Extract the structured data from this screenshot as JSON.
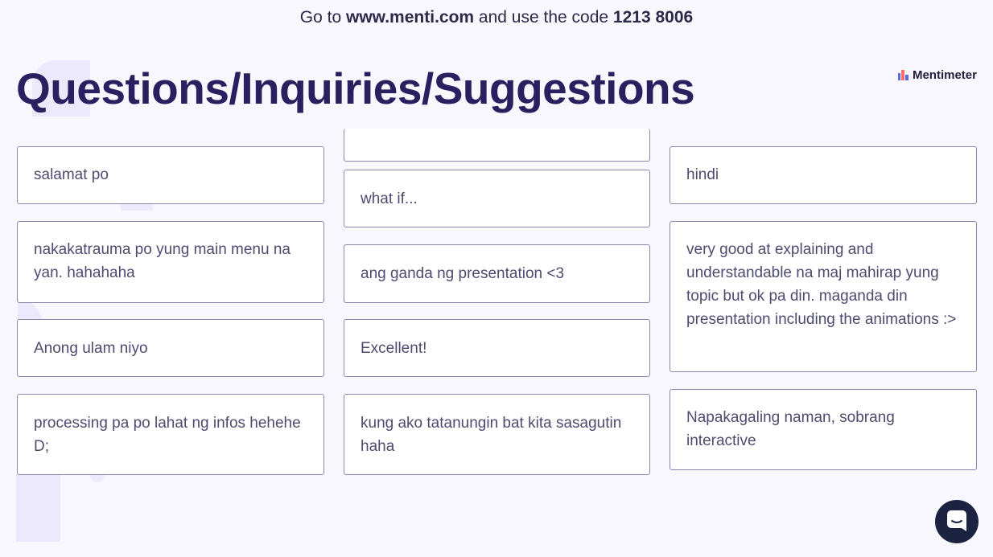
{
  "topbar": {
    "prefix": "Go to ",
    "url": "www.menti.com",
    "middle": " and use the code ",
    "code": "1213 8006"
  },
  "slide": {
    "title": "Questions/Inquiries/Suggestions",
    "brand": "Mentimeter"
  },
  "responses": {
    "col1": [
      "salamat po",
      "nakakatrauma po yung main menu na yan. hahahaha",
      "Anong ulam niyo",
      "processing pa po lahat ng infos hehehe D;"
    ],
    "col2": [
      "",
      "what if...",
      "ang ganda ng presentation <3",
      "Excellent!",
      "kung ako tatanungin bat kita sasagutin haha"
    ],
    "col3": [
      "hindi",
      "very good at explaining and understandable na maj mahirap yung topic but ok pa din. maganda din presentation including the animations :>",
      "Napakagaling naman, sobrang interactive"
    ]
  },
  "icons": {
    "brand_logo": "mentimeter-logo-icon",
    "chat": "chat-bubble-icon"
  },
  "colors": {
    "title": "#2a2060",
    "background": "#f8f7fd",
    "card_border": "#8a88b0",
    "chat_button": "#1c2340"
  }
}
